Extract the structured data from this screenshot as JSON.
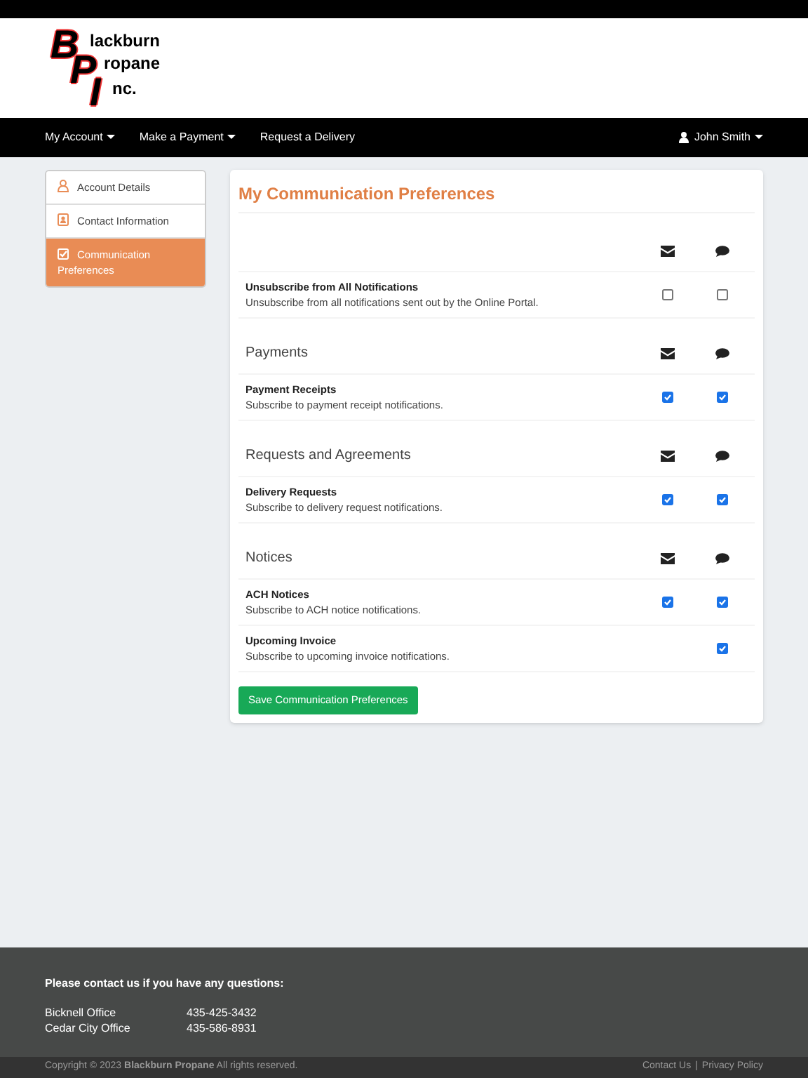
{
  "logo": {
    "initials": [
      "B",
      "P",
      "I"
    ],
    "lines": [
      "lackburn",
      "ropane",
      "nc."
    ]
  },
  "nav": {
    "items": [
      {
        "label": "My Account",
        "dropdown": true
      },
      {
        "label": "Make a Payment",
        "dropdown": true
      },
      {
        "label": "Request a Delivery",
        "dropdown": false
      }
    ],
    "user": "John Smith"
  },
  "sidebar": {
    "items": [
      {
        "label": "Account Details",
        "selected": false
      },
      {
        "label": "Contact Information",
        "selected": false
      },
      {
        "label": "Communication Preferences",
        "selected": true
      }
    ]
  },
  "title": "My Communication Preferences",
  "sections": [
    {
      "items": [
        {
          "name": "Unsubscribe from All Notifications",
          "description": "Unsubscribe from all notifications sent out by the Online Portal.",
          "email": false,
          "sms": false
        }
      ]
    },
    {
      "heading": "Payments",
      "items": [
        {
          "name": "Payment Receipts",
          "description": "Subscribe to payment receipt notifications.",
          "email": true,
          "sms": true
        }
      ]
    },
    {
      "heading": "Requests and Agreements",
      "items": [
        {
          "name": "Delivery Requests",
          "description": "Subscribe to delivery request notifications.",
          "email": true,
          "sms": true
        }
      ]
    },
    {
      "heading": "Notices",
      "items": [
        {
          "name": "ACH Notices",
          "description": "Subscribe to ACH notice notifications.",
          "email": true,
          "sms": true
        },
        {
          "name": "Upcoming Invoice",
          "description": "Subscribe to upcoming invoice notifications.",
          "sms": true
        }
      ]
    }
  ],
  "save_button": "Save Communication Preferences",
  "footer": {
    "heading": "Please contact us if you have any questions:",
    "offices": [
      {
        "name": "Bicknell Office",
        "phone": "435-425-3432"
      },
      {
        "name": "Cedar City Office",
        "phone": "435-586-8931"
      }
    ],
    "copyright": "Copyright © 2023 **Blackburn Propane** All rights reserved.",
    "links": [
      "Contact Us",
      "|",
      "Privacy Policy"
    ]
  }
}
